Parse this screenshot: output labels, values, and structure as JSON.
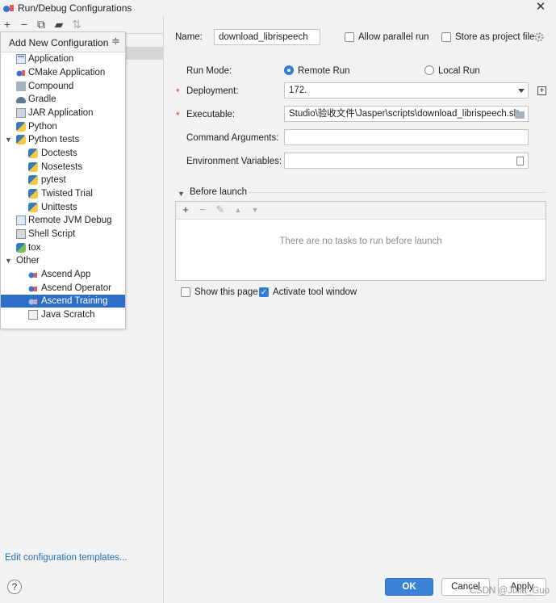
{
  "window": {
    "title": "Run/Debug Configurations"
  },
  "toolbar": {
    "add": "+",
    "remove": "−",
    "copy": "⧉",
    "folder": "▰",
    "sort": "⇅"
  },
  "popup": {
    "header": "Add New Configuration",
    "items": [
      {
        "label": "Application",
        "icon": "application-icon"
      },
      {
        "label": "CMake Application",
        "icon": "cmake-icon"
      },
      {
        "label": "Compound",
        "icon": "compound-icon"
      },
      {
        "label": "Gradle",
        "icon": "gradle-icon"
      },
      {
        "label": "JAR Application",
        "icon": "jar-icon"
      },
      {
        "label": "Python",
        "icon": "python-icon"
      },
      {
        "label": "Python tests",
        "icon": "python-tests-icon"
      },
      {
        "label": "Doctests",
        "icon": "python-test-icon"
      },
      {
        "label": "Nosetests",
        "icon": "python-test-icon"
      },
      {
        "label": "pytest",
        "icon": "python-test-icon"
      },
      {
        "label": "Twisted Trial",
        "icon": "python-test-icon"
      },
      {
        "label": "Unittests",
        "icon": "python-test-icon"
      },
      {
        "label": "Remote JVM Debug",
        "icon": "remote-debug-icon"
      },
      {
        "label": "Shell Script",
        "icon": "shell-icon"
      },
      {
        "label": "tox",
        "icon": "tox-icon"
      },
      {
        "label": "Other",
        "icon": ""
      },
      {
        "label": "Ascend App",
        "icon": "ascend-icon"
      },
      {
        "label": "Ascend Operator",
        "icon": "ascend-icon"
      },
      {
        "label": "Ascend Training",
        "icon": "ascend-icon"
      },
      {
        "label": "Java Scratch",
        "icon": "java-scratch-icon"
      }
    ]
  },
  "form": {
    "name_label": "Name:",
    "name_value": "download_librispeech",
    "allow_parallel": "Allow parallel run",
    "store_project": "Store as project file",
    "run_mode_label": "Run Mode:",
    "remote_run": "Remote Run",
    "local_run": "Local Run",
    "deployment_label": "Deployment:",
    "deployment_value": "172.",
    "executable_label": "Executable:",
    "executable_value": "Studio\\验收文件\\Jasper\\scripts\\download_librispeech.sh",
    "command_args_label": "Command Arguments:",
    "env_vars_label": "Environment Variables:",
    "required_mark": "*"
  },
  "before_launch": {
    "title": "Before launch",
    "empty": "There are no tasks to run before launch",
    "add": "+",
    "remove": "−",
    "edit": "✎",
    "up": "▲",
    "down": "▼"
  },
  "options": {
    "show_page": "Show this page",
    "activate_tool": "Activate tool window"
  },
  "footer": {
    "edit_templates": "Edit configuration templates...",
    "help": "?",
    "ok": "OK",
    "cancel": "Cancel",
    "apply": "Apply",
    "watermark": "CSDN @Julia_Guo"
  }
}
